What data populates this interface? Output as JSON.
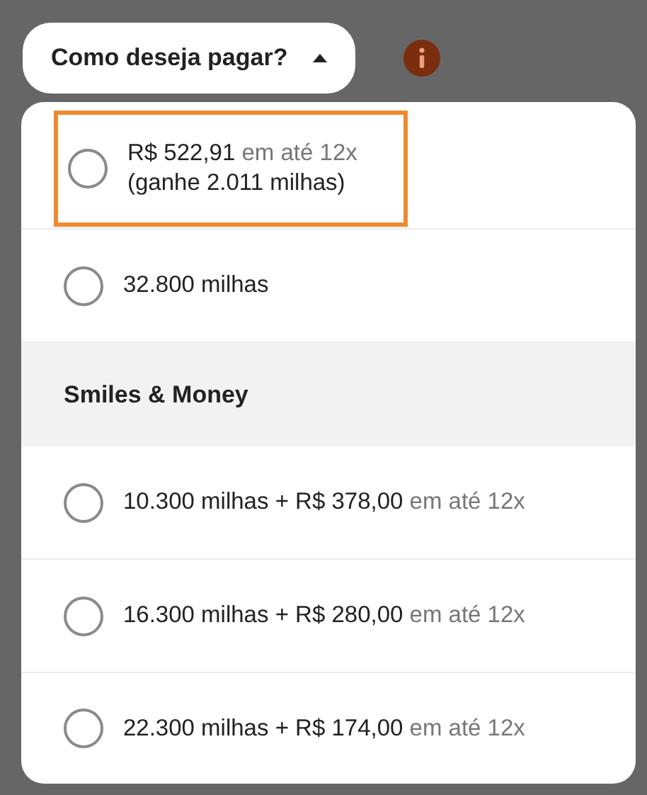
{
  "dropdown": {
    "label": "Como deseja pagar?",
    "expanded": true
  },
  "items": [
    {
      "kind": "option",
      "amount": "R$ 522,91",
      "terms": "em até 12x",
      "note": "(ganhe 2.011 milhas)",
      "selected": false,
      "highlighted": true
    },
    {
      "kind": "option",
      "amount": "32.800 milhas",
      "selected": false,
      "highlighted": false
    },
    {
      "kind": "header",
      "label": "Smiles & Money"
    },
    {
      "kind": "option",
      "amount": "10.300 milhas + R$ 378,00",
      "terms": "em até 12x",
      "selected": false,
      "highlighted": false
    },
    {
      "kind": "option",
      "amount": "16.300 milhas + R$ 280,00",
      "terms": "em até 12x",
      "selected": false,
      "highlighted": false
    },
    {
      "kind": "option",
      "amount": "22.300 milhas + R$ 174,00",
      "terms": "em até 12x",
      "selected": false,
      "highlighted": false
    }
  ]
}
